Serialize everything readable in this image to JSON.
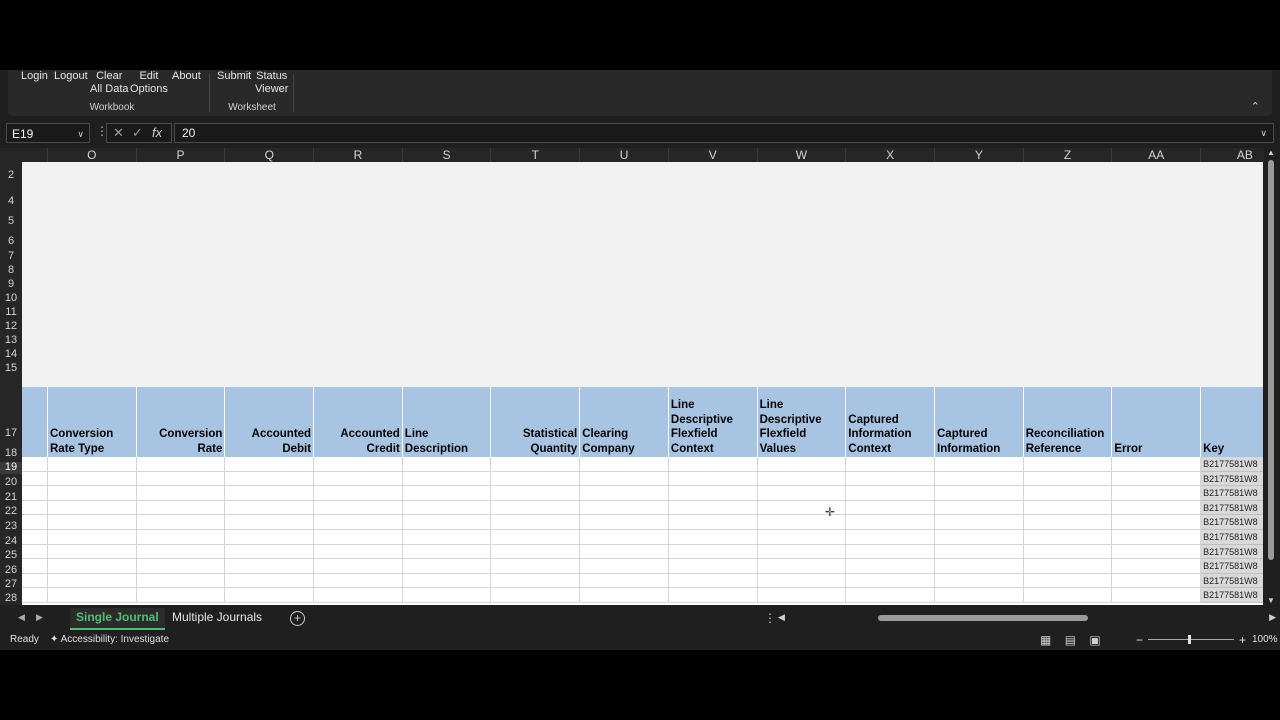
{
  "ribbon": {
    "buttons": [
      {
        "name": "login-button",
        "label": "Login"
      },
      {
        "name": "logout-button",
        "label": "Logout"
      },
      {
        "name": "clear-all-data-button",
        "label": "Clear\nAll Data"
      },
      {
        "name": "edit-options-button",
        "label": "Edit\nOptions"
      },
      {
        "name": "about-button",
        "label": "About"
      },
      {
        "name": "submit-button",
        "label": "Submit"
      },
      {
        "name": "status-viewer-button",
        "label": "Status\nViewer"
      }
    ],
    "groups": {
      "workbook": "Workbook",
      "worksheet": "Worksheet"
    },
    "collapse_icon": "chevron-up-icon"
  },
  "formula_bar": {
    "name_box": "E19",
    "formula_value": "20"
  },
  "columns": [
    "O",
    "P",
    "Q",
    "R",
    "S",
    "T",
    "U",
    "V",
    "W",
    "X",
    "Y",
    "Z",
    "AA",
    "AB"
  ],
  "rows": [
    "2",
    "4",
    "5",
    "6",
    "7",
    "8",
    "9",
    "10",
    "11",
    "12",
    "13",
    "14",
    "15",
    "17",
    "18",
    "19",
    "20",
    "21",
    "22",
    "23",
    "24",
    "25",
    "26",
    "27",
    "28"
  ],
  "selected_row": "19",
  "table_headers": [
    {
      "label": "Conversion\nRate Type",
      "align": "left"
    },
    {
      "label": "Conversion\nRate",
      "align": "right"
    },
    {
      "label": "Accounted\nDebit",
      "align": "right"
    },
    {
      "label": "Accounted\nCredit",
      "align": "right"
    },
    {
      "label": "Line\nDescription",
      "align": "left"
    },
    {
      "label": "Statistical\nQuantity",
      "align": "right"
    },
    {
      "label": "Clearing\nCompany",
      "align": "left"
    },
    {
      "label": "Line\nDescriptive\nFlexfield\nContext",
      "align": "left"
    },
    {
      "label": "Line\nDescriptive\nFlexfield\nValues",
      "align": "left"
    },
    {
      "label": "Captured\nInformation\nContext",
      "align": "left"
    },
    {
      "label": "Captured\nInformation",
      "align": "left"
    },
    {
      "label": "Reconciliation\nReference",
      "align": "left"
    },
    {
      "label": "Error",
      "align": "left"
    },
    {
      "label": "Key",
      "align": "left"
    }
  ],
  "key_values": [
    "B2177581W8",
    "B2177581W8",
    "B2177581W8",
    "B2177581W8",
    "B2177581W8",
    "B2177581W8",
    "B2177581W8",
    "B2177581W8",
    "B2177581W8",
    "B2177581W8"
  ],
  "sheet_tabs": [
    {
      "label": "Single Journal",
      "active": true
    },
    {
      "label": "Multiple Journals",
      "active": false
    }
  ],
  "status_bar": {
    "ready": "Ready",
    "accessibility": "Accessibility: Investigate",
    "zoom": "100%"
  }
}
